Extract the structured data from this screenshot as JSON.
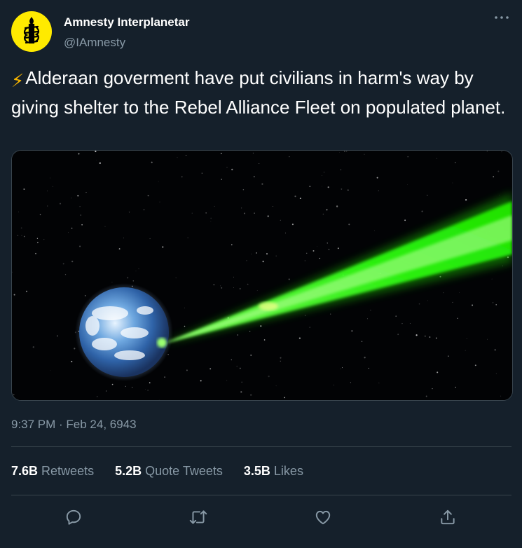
{
  "author": {
    "display_name": "Amnesty Interplanetar",
    "handle": "@IAmnesty",
    "avatar_icon": "candle-in-barbed-wire-logo",
    "avatar_color": "#ffea00"
  },
  "tweet": {
    "text": "Alderaan goverment have put civilians in harm's way by giving shelter to the Rebel Alliance Fleet on populated planet.",
    "emoji": "⚡",
    "timestamp": "9:37 PM · Feb 24, 6943"
  },
  "media": {
    "icon": "planet-laser-image"
  },
  "stats": {
    "retweets_count": "7.6B",
    "retweets_label": "Retweets",
    "quotes_count": "5.2B",
    "quotes_label": "Quote Tweets",
    "likes_count": "3.5B",
    "likes_label": "Likes"
  },
  "actions": [
    "reply-icon",
    "retweet-icon",
    "like-icon",
    "share-icon"
  ],
  "colors": {
    "background": "#15202b",
    "secondary_text": "#8899a6",
    "divider": "#38444d",
    "laser": "#39ff14"
  }
}
